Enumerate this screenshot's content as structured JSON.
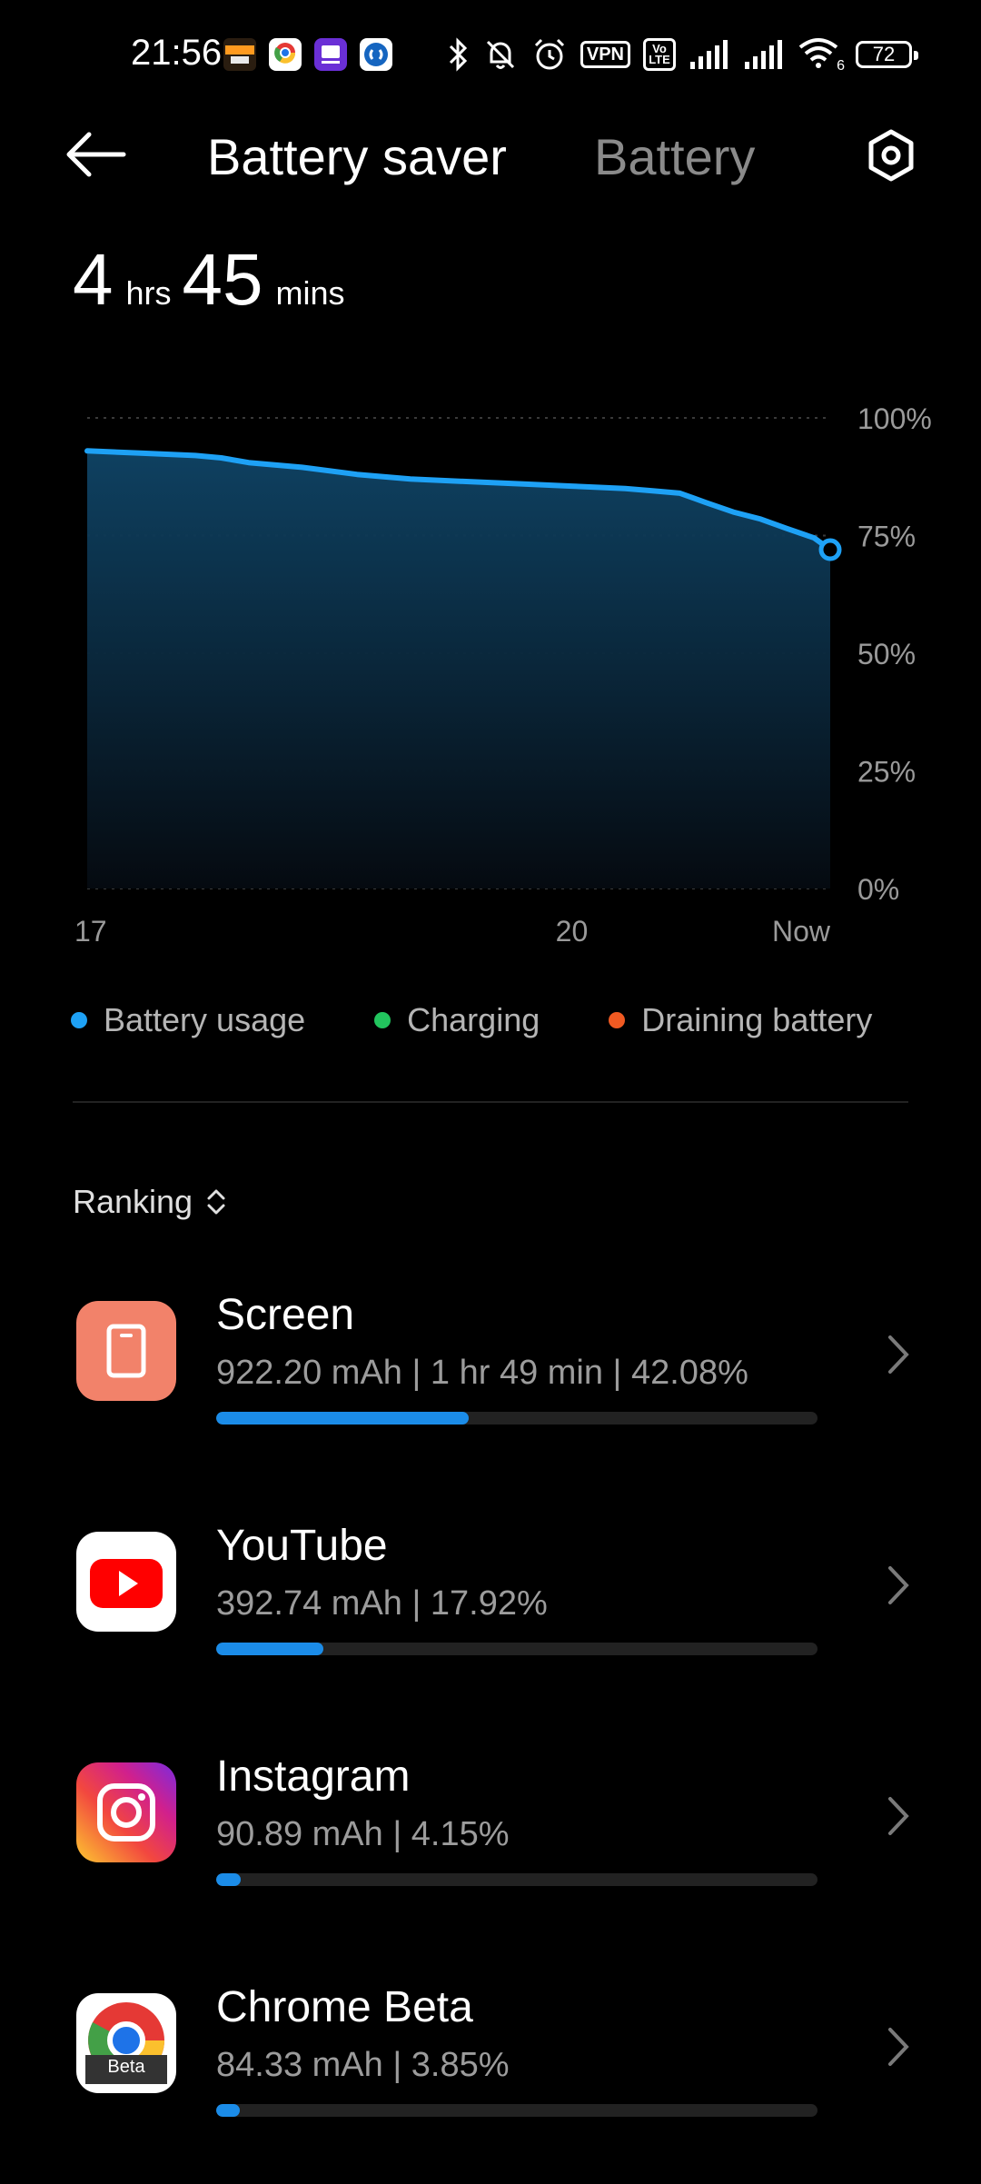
{
  "status_bar": {
    "time": "21:56",
    "vpn": "VPN",
    "volte": "Vo LTE",
    "battery_level": "72",
    "wifi_label": "6"
  },
  "header": {
    "tab_active": "Battery saver",
    "tab_inactive": "Battery"
  },
  "remaining": {
    "hours": "4",
    "hours_unit": "hrs",
    "minutes": "45",
    "minutes_unit": "mins"
  },
  "chart_data": {
    "type": "area",
    "x": [
      17,
      17.33,
      17.67,
      17.83,
      18.0,
      18.33,
      18.67,
      19.0,
      19.33,
      19.67,
      20.0,
      20.33,
      20.5,
      20.67,
      20.83,
      21.0,
      21.17,
      21.33,
      21.5,
      21.6
    ],
    "values": [
      93,
      92.5,
      92,
      91.5,
      90.5,
      89.5,
      88,
      87,
      86.5,
      86,
      85.5,
      85,
      84.5,
      84,
      82,
      80,
      78.5,
      76.5,
      74.5,
      72
    ],
    "ylim": [
      0,
      100
    ],
    "y_ticks": [
      "100%",
      "75%",
      "50%",
      "25%",
      "0%"
    ],
    "y_tick_values": [
      100,
      75,
      50,
      25,
      0
    ],
    "x_ticks": [
      "17",
      "20",
      "Now"
    ],
    "x_tick_values": [
      17,
      20,
      21.6
    ],
    "grid": true,
    "series_color": "#1ea1f5"
  },
  "legend": {
    "items": [
      {
        "label": "Battery usage",
        "color": "#1ea1f5"
      },
      {
        "label": "Charging",
        "color": "#22c55e"
      },
      {
        "label": "Draining battery",
        "color": "#f05a22"
      }
    ]
  },
  "ranking": {
    "label": "Ranking"
  },
  "apps": [
    {
      "name": "Screen",
      "detail": "922.20 mAh | 1 hr 49 min  | 42.08%",
      "percent": 42.08,
      "icon": "screen-icon"
    },
    {
      "name": "YouTube",
      "detail": "392.74 mAh | 17.92%",
      "percent": 17.92,
      "icon": "youtube-icon"
    },
    {
      "name": "Instagram",
      "detail": "90.89 mAh | 4.15%",
      "percent": 4.15,
      "icon": "instagram-icon"
    },
    {
      "name": "Chrome Beta",
      "detail": "84.33 mAh | 3.85%",
      "percent": 3.85,
      "icon": "chrome-beta-icon",
      "badge": "Beta"
    }
  ]
}
